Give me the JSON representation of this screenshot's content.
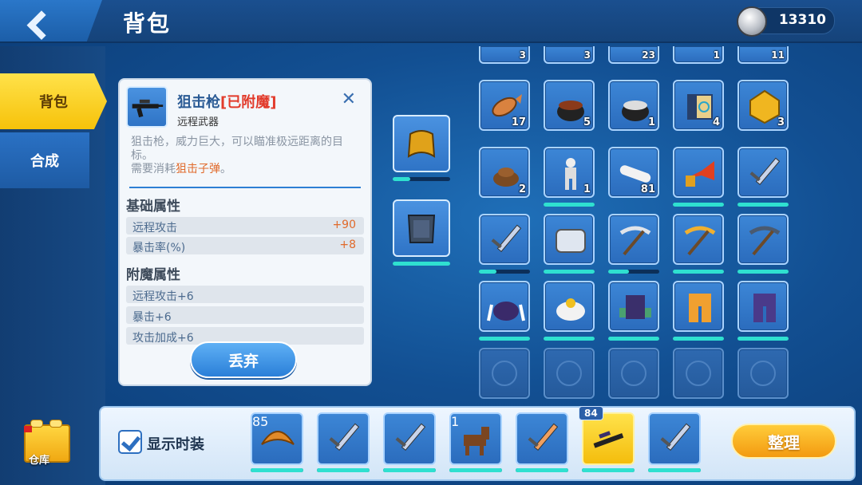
{
  "header": {
    "title": "背包",
    "coins": "13310",
    "back_icon": "back-arrow-icon",
    "coin_icon": "silver-coin-icon"
  },
  "sidebar": {
    "items": [
      {
        "label": "背包",
        "active": true
      },
      {
        "label": "合成",
        "active": false
      }
    ],
    "storage_label": "仓库"
  },
  "tooltip": {
    "name": "狙击枪",
    "tag": "[已附魔]",
    "type": "远程武器",
    "desc_line1": "狙击枪，威力巨大，可以瞄准极远距离的目标。",
    "desc_prefix": "需要消耗",
    "desc_ammo": "狙击子弹",
    "desc_suffix": "。",
    "base_title": "基础属性",
    "base_stats": [
      {
        "label": "远程攻击",
        "value": "+90"
      },
      {
        "label": "暴击率(%)",
        "value": "+8"
      }
    ],
    "ench_title": "附魔属性",
    "ench_stats": [
      "远程攻击+6",
      "暴击+6",
      "攻击加成+6"
    ],
    "discard_label": "丢弃"
  },
  "inventory": {
    "top_row_counts": [
      "3",
      "3",
      "23",
      "1",
      "11"
    ],
    "rows": [
      [
        {
          "icon": "fish-icon",
          "count": "17"
        },
        {
          "icon": "stew-pot-icon",
          "count": "5"
        },
        {
          "icon": "soup-pot-icon",
          "count": "1"
        },
        {
          "icon": "map-scroll-icon",
          "count": "4"
        },
        {
          "icon": "gold-gem-icon",
          "count": "3"
        }
      ],
      [
        {
          "icon": "brown-brick-icon",
          "count": "2"
        },
        {
          "icon": "skeleton-icon",
          "count": "1"
        },
        {
          "icon": "white-bone-icon",
          "count": "81"
        },
        {
          "icon": "horn-trumpet-icon",
          "count": ""
        },
        {
          "icon": "sword-icon",
          "count": ""
        }
      ],
      [
        {
          "icon": "sword-icon",
          "count": ""
        },
        {
          "icon": "armor-plate-icon",
          "count": ""
        },
        {
          "icon": "pickaxe-silver-icon",
          "count": ""
        },
        {
          "icon": "pickaxe-gold-icon",
          "count": ""
        },
        {
          "icon": "pickaxe-dark-icon",
          "count": ""
        }
      ],
      [
        {
          "icon": "viking-helmet-icon",
          "count": ""
        },
        {
          "icon": "miner-helmet-icon",
          "count": ""
        },
        {
          "icon": "monster-torso-icon",
          "count": ""
        },
        {
          "icon": "orange-legs-icon",
          "count": ""
        },
        {
          "icon": "purple-legs-icon",
          "count": ""
        }
      ]
    ],
    "durability": [
      [
        null,
        null,
        null,
        null,
        null
      ],
      [
        null,
        1.0,
        null,
        1.0,
        1.0
      ],
      [
        0.35,
        1.0,
        0.4,
        1.0,
        1.0
      ],
      [
        1.0,
        1.0,
        1.0,
        1.0,
        1.0
      ]
    ]
  },
  "equipment": {
    "slots": [
      {
        "icon": "yellow-helmet-icon",
        "durability": 0.3
      },
      {
        "icon": "dark-armor-icon",
        "durability": 1.0
      }
    ]
  },
  "tray": {
    "show_fashion_label": "显示时装",
    "show_fashion_checked": true,
    "sort_label": "整理",
    "slots": [
      {
        "icon": "croissant-icon",
        "count": "85",
        "badge": "",
        "selected": false
      },
      {
        "icon": "sword-icon",
        "count": "",
        "badge": "",
        "selected": false
      },
      {
        "icon": "sword-icon",
        "count": "",
        "badge": "",
        "selected": false
      },
      {
        "icon": "horse-icon",
        "count": "1",
        "badge": "",
        "selected": false
      },
      {
        "icon": "fire-sword-icon",
        "count": "",
        "badge": "",
        "selected": false
      },
      {
        "icon": "sniper-rifle-icon",
        "count": "",
        "badge": "84",
        "selected": true
      },
      {
        "icon": "sparkle-sword-icon",
        "count": "",
        "badge": "",
        "selected": false
      }
    ]
  },
  "colors": {
    "accent_yellow": "#f6c20a",
    "durability": "#2fe0d0",
    "enchant_red": "#e23b2b",
    "value_orange": "#e06a2b"
  }
}
